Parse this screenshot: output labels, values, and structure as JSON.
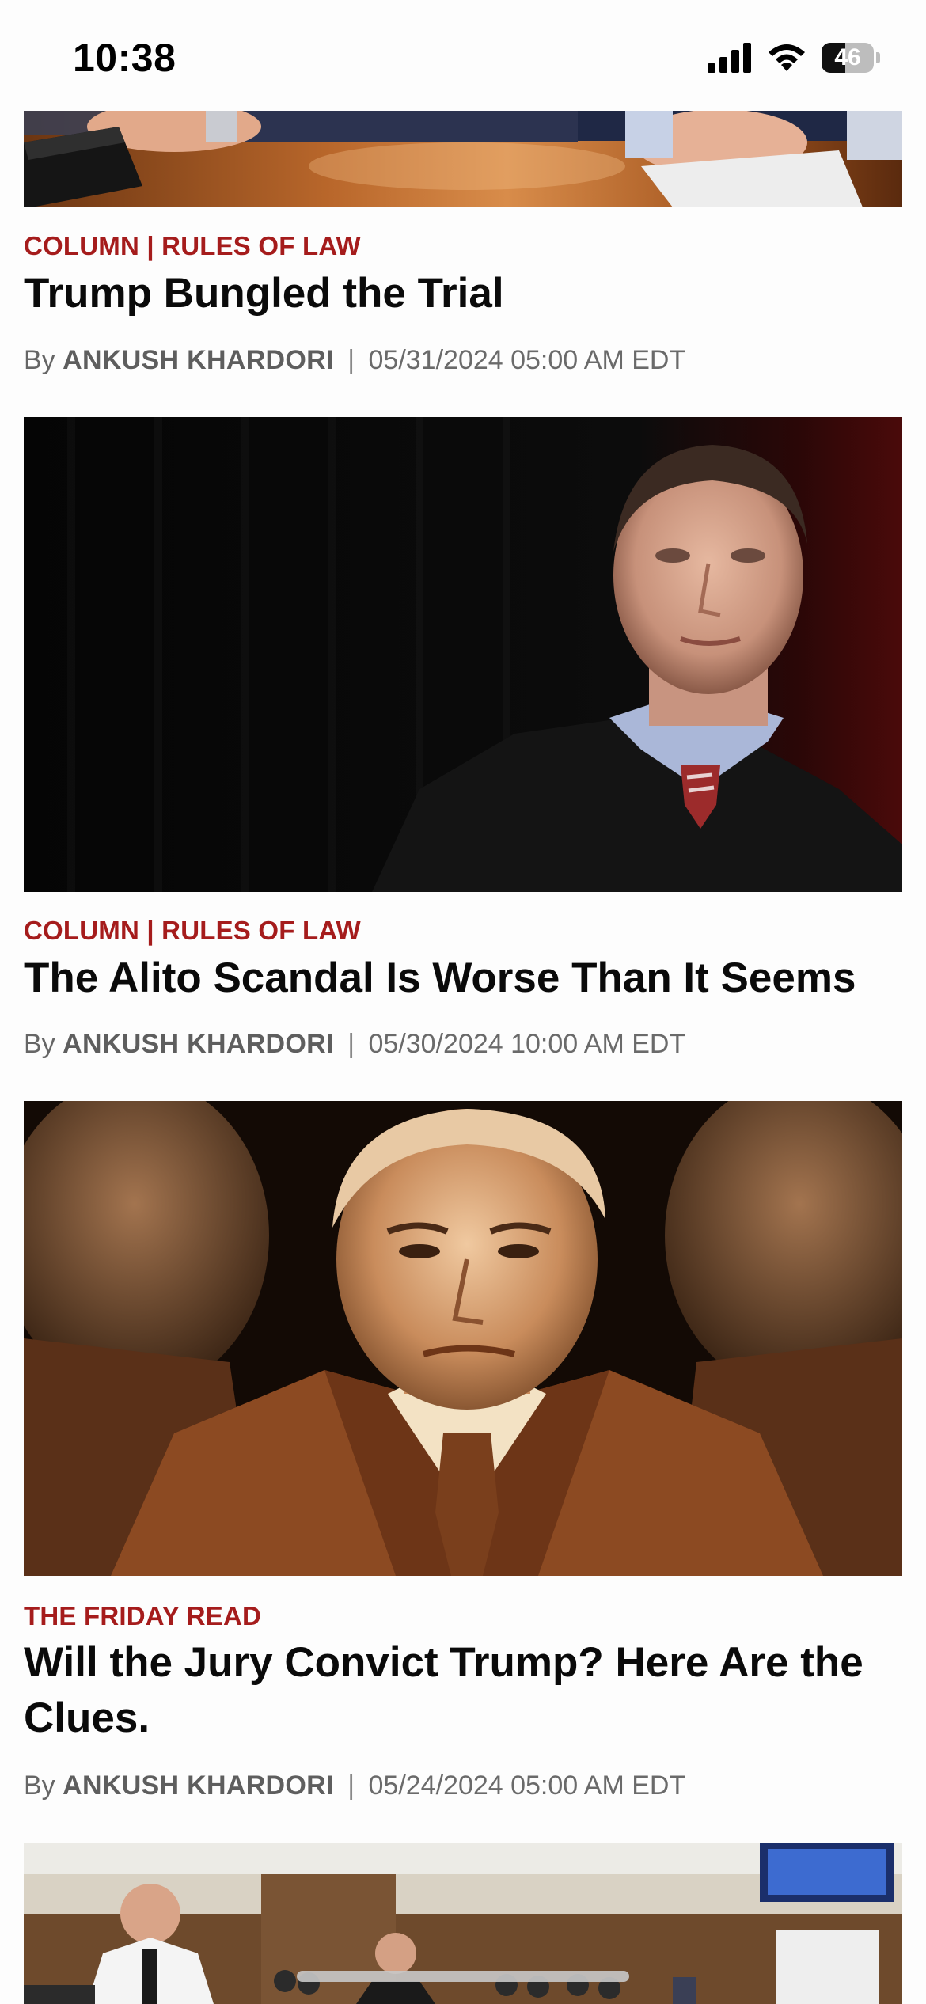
{
  "status_bar": {
    "time": "10:38",
    "battery_level": "46",
    "battery_fraction": 0.46,
    "icons": [
      "cellular-signal-icon",
      "wifi-icon",
      "battery-icon"
    ]
  },
  "articles": [
    {
      "kicker": "COLUMN | RULES OF LAW",
      "headline": "Trump Bungled the Trial",
      "by": "By",
      "author": "ANKUSH KHARDORI",
      "separator": "|",
      "date": "05/31/2024 05:00 AM EDT",
      "image": "courtroom-table-hands-photo"
    },
    {
      "kicker": "COLUMN | RULES OF LAW",
      "headline": "The Alito Scandal Is Worse Than It Seems",
      "by": "By",
      "author": "ANKUSH KHARDORI",
      "separator": "|",
      "date": "05/30/2024 10:00 AM EDT",
      "image": "justice-portrait-photo"
    },
    {
      "kicker": "THE FRIDAY READ",
      "headline": "Will the Jury Convict Trump? Here Are the Clues.",
      "by": "By",
      "author": "ANKUSH KHARDORI",
      "separator": "|",
      "date": "05/24/2024 05:00 AM EDT",
      "image": "triple-portrait-photo"
    },
    {
      "image": "courtroom-interior-photo"
    }
  ],
  "colors": {
    "kicker": "#a51c1c",
    "headline": "#0a0a0a",
    "byline": "#666666",
    "background": "#fdfdfd"
  }
}
